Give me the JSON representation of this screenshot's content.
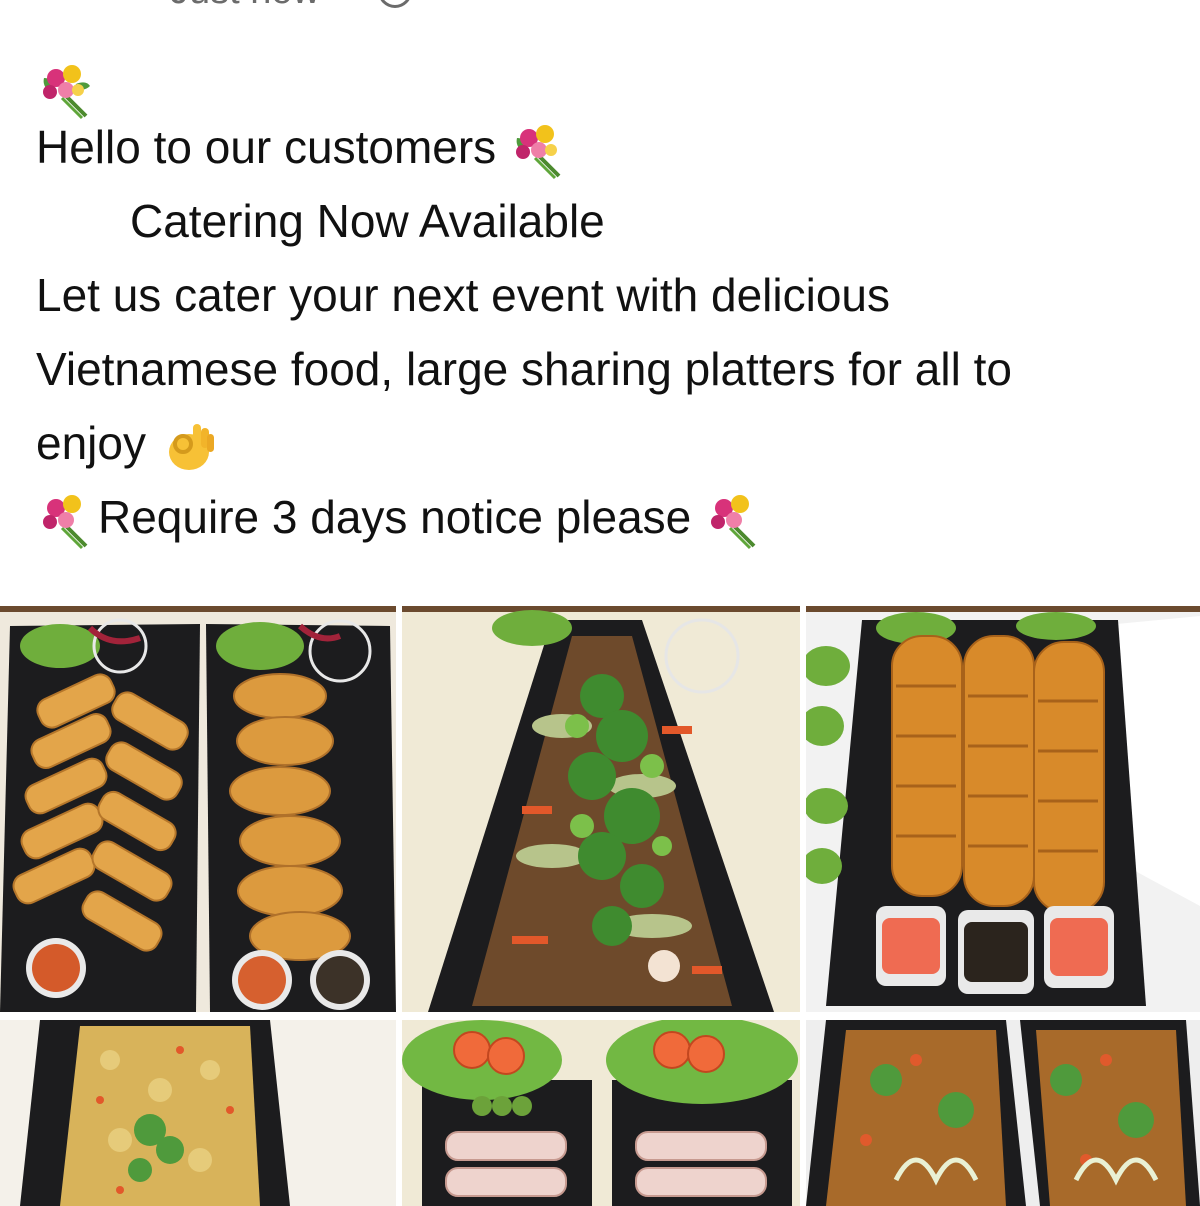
{
  "post": {
    "timestamp": "Just now",
    "audience_icon": "globe-icon",
    "emoji_icon": "bouquet-emoji",
    "ok_icon": "ok-hand-emoji",
    "greeting": "Hello to our customers",
    "headline": "Catering Now Available",
    "body_line_1": "Let us cater your next event with delicious",
    "body_line_2": "Vietnamese food, large sharing platters for all to",
    "body_line_3": "enjoy",
    "notice": "Require 3 days notice please"
  },
  "photos": [
    {
      "name": "spring-rolls-and-chicken-wings-platter"
    },
    {
      "name": "beef-vegetable-stir-fry-platter"
    },
    {
      "name": "chicken-skewers-with-dipping-sauces"
    },
    {
      "name": "fried-rice-platter"
    },
    {
      "name": "rice-paper-rolls-with-salad"
    },
    {
      "name": "stir-fried-noodles-platter"
    }
  ],
  "colors": {
    "text": "#111111",
    "meta_text": "#6b6b6b",
    "tray": "#1c1c1e"
  }
}
